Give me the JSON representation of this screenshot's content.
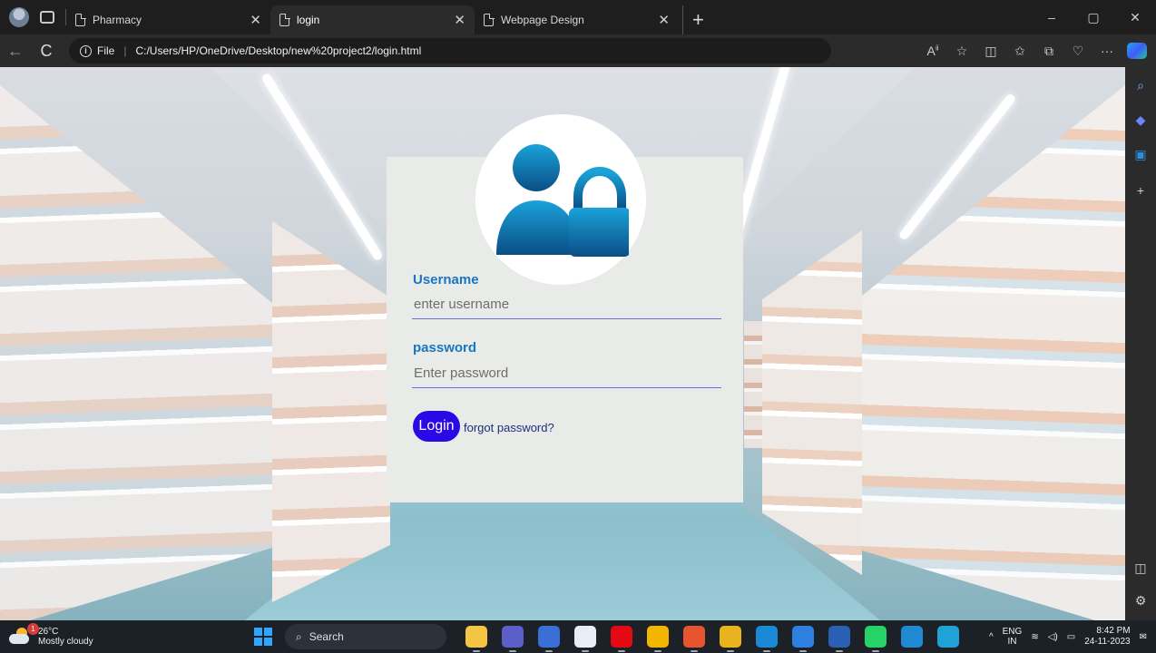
{
  "browser": {
    "tabs": [
      {
        "label": "Pharmacy",
        "active": false
      },
      {
        "label": "login",
        "active": true
      },
      {
        "label": "Webpage Design",
        "active": false
      }
    ],
    "new_tab_label": "+",
    "window_controls": {
      "minimize": "–",
      "maximize": "▢",
      "close": "✕"
    },
    "address": {
      "scheme_label": "File",
      "separator": "|",
      "url": "C:/Users/HP/OneDrive/Desktop/new%20project2/login.html"
    },
    "nav": {
      "back": "←",
      "refresh": "C"
    }
  },
  "page": {
    "username": {
      "label": "Username",
      "placeholder": "enter username",
      "value": ""
    },
    "password": {
      "label": "password",
      "placeholder": "Enter password",
      "value": ""
    },
    "login_button": "Login",
    "forgot_link": "forgot password?",
    "colors": {
      "label_blue": "#1976bf",
      "button_blue": "#2b08e6",
      "card_bg": "#e9ebe8",
      "underline": "#6a6cdf"
    }
  },
  "taskbar": {
    "weather": {
      "temp": "26°C",
      "condition": "Mostly cloudy",
      "badge": "1"
    },
    "search_label": "Search",
    "language": {
      "line1": "ENG",
      "line2": "IN"
    },
    "clock": {
      "time": "8:42 PM",
      "date": "24-11-2023"
    },
    "apps": [
      {
        "name": "file-explorer-icon",
        "color": "#f4c542"
      },
      {
        "name": "teams-icon",
        "color": "#5b5fc7"
      },
      {
        "name": "dev-icon",
        "color": "#3a6fd8"
      },
      {
        "name": "infinity-icon",
        "color": "#e8eef6"
      },
      {
        "name": "netflix-icon",
        "color": "#e50914"
      },
      {
        "name": "folder-icon",
        "color": "#f2b600"
      },
      {
        "name": "office-icon",
        "color": "#e8542d"
      },
      {
        "name": "chrome-icon",
        "color": "#e8b31c"
      },
      {
        "name": "mail-icon",
        "color": "#1a8ad6"
      },
      {
        "name": "chrome2-icon",
        "color": "#2f7fe0"
      },
      {
        "name": "word-icon",
        "color": "#2a5fb5"
      },
      {
        "name": "whatsapp-icon",
        "color": "#25d366"
      },
      {
        "name": "vscode-icon",
        "color": "#1f8ad2"
      },
      {
        "name": "edge-icon",
        "color": "#1fa2d8"
      }
    ]
  }
}
